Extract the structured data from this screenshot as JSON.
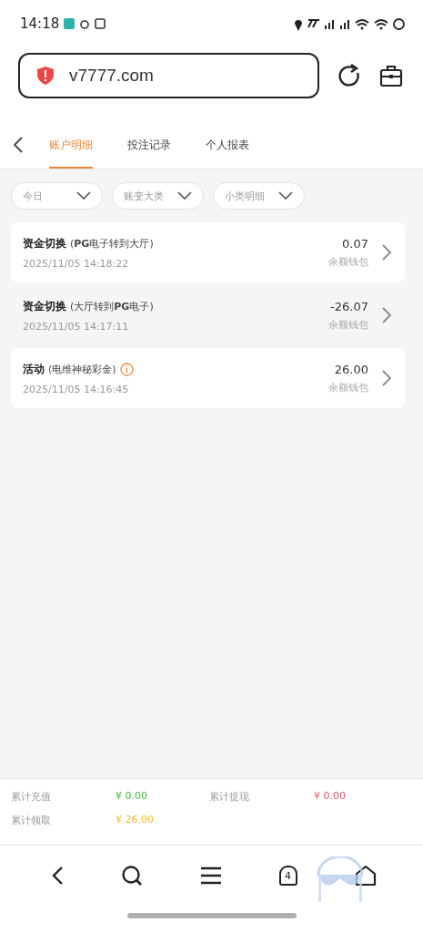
{
  "status_bar": {
    "time": "14:18"
  },
  "address_bar": {
    "url": "v7777.com"
  },
  "tabs": [
    {
      "label": "账户明细",
      "selected": true
    },
    {
      "label": "投注记录",
      "selected": false
    },
    {
      "label": "个人报表",
      "selected": false
    }
  ],
  "filters": [
    {
      "label": "今日"
    },
    {
      "label": "账变大类"
    },
    {
      "label": "小类明细"
    }
  ],
  "records": [
    {
      "title": "资金切换",
      "detail": "(**PG**电子转到大厅)",
      "info": false,
      "time": "2025/11/05 14:18:22",
      "amount": "0.07",
      "wallet": "余额钱包"
    },
    {
      "title": "资金切换",
      "detail": "(大厅转到**PG**电子)",
      "info": false,
      "time": "2025/11/05 14:17:11",
      "amount": "-26.07",
      "wallet": "余额钱包"
    },
    {
      "title": "活动",
      "detail": "(电维神秘彩金)",
      "info": true,
      "time": "2025/11/05 14:16:45",
      "amount": "26.00",
      "wallet": "余额钱包"
    }
  ],
  "summary": [
    {
      "label": "累计充值",
      "value": "¥ 0.00",
      "color": "#3cb83c"
    },
    {
      "label": "累计提现",
      "value": "¥ 0.00",
      "color": "#e0525a"
    },
    {
      "label": "累计领取",
      "value": "¥ 26.00",
      "color": "#f0b830"
    }
  ],
  "nav_bar": {
    "tab_count": "4"
  }
}
